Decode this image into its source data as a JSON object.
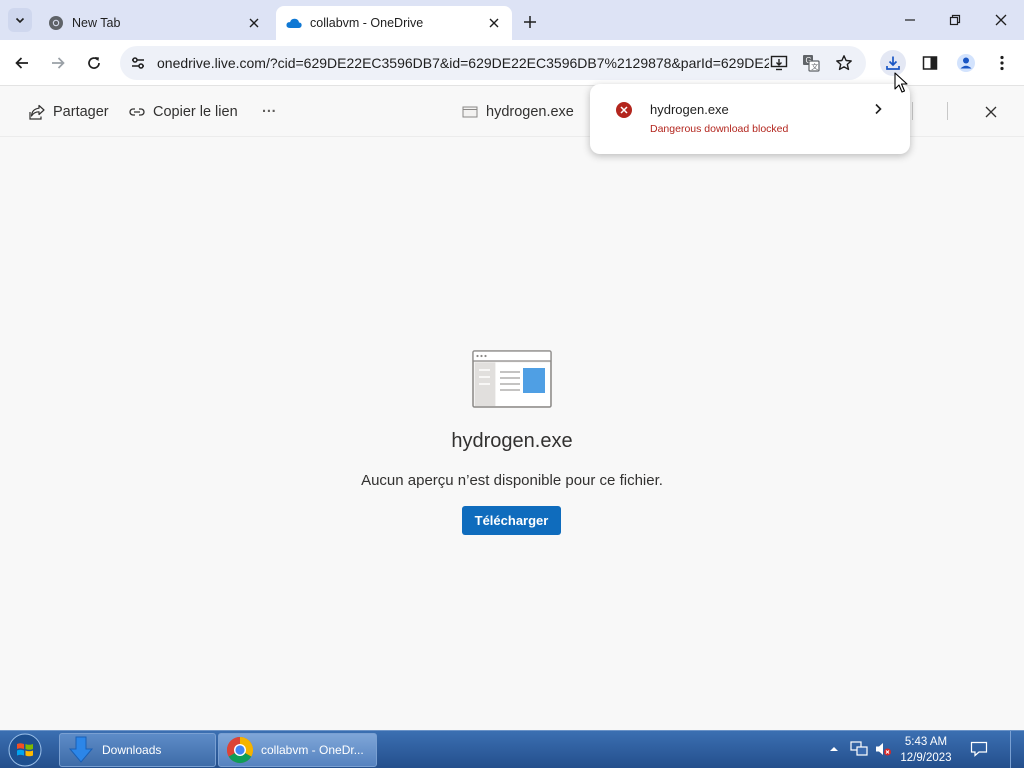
{
  "browser": {
    "tabs": [
      {
        "label": "New Tab",
        "icon": "chrome-icon",
        "active": false
      },
      {
        "label": "collabvm - OneDrive",
        "icon": "onedrive-icon",
        "active": true
      }
    ],
    "url": "onedrive.live.com/?cid=629DE22EC3596DB7&id=629DE22EC3596DB7%2129878&parId=629DE2..."
  },
  "commandbar": {
    "share_label": "Partager",
    "copy_link_label": "Copier le lien",
    "more_label": "···",
    "file_name": "hydrogen.exe"
  },
  "main": {
    "file_title": "hydrogen.exe",
    "no_preview_text": "Aucun aperçu n’est disponible pour ce fichier.",
    "download_button": "Télécharger"
  },
  "download_bubble": {
    "file_name": "hydrogen.exe",
    "status": "Dangerous download blocked",
    "status_color": "#b3261e"
  },
  "taskbar": {
    "items": [
      {
        "label": "Downloads"
      },
      {
        "label": "collabvm - OneDr..."
      }
    ],
    "time": "5:43 AM",
    "date": "12/9/2023"
  },
  "colors": {
    "accent": "#0f6cbd",
    "tabstrip": "#dde3f5",
    "error": "#b3261e"
  }
}
